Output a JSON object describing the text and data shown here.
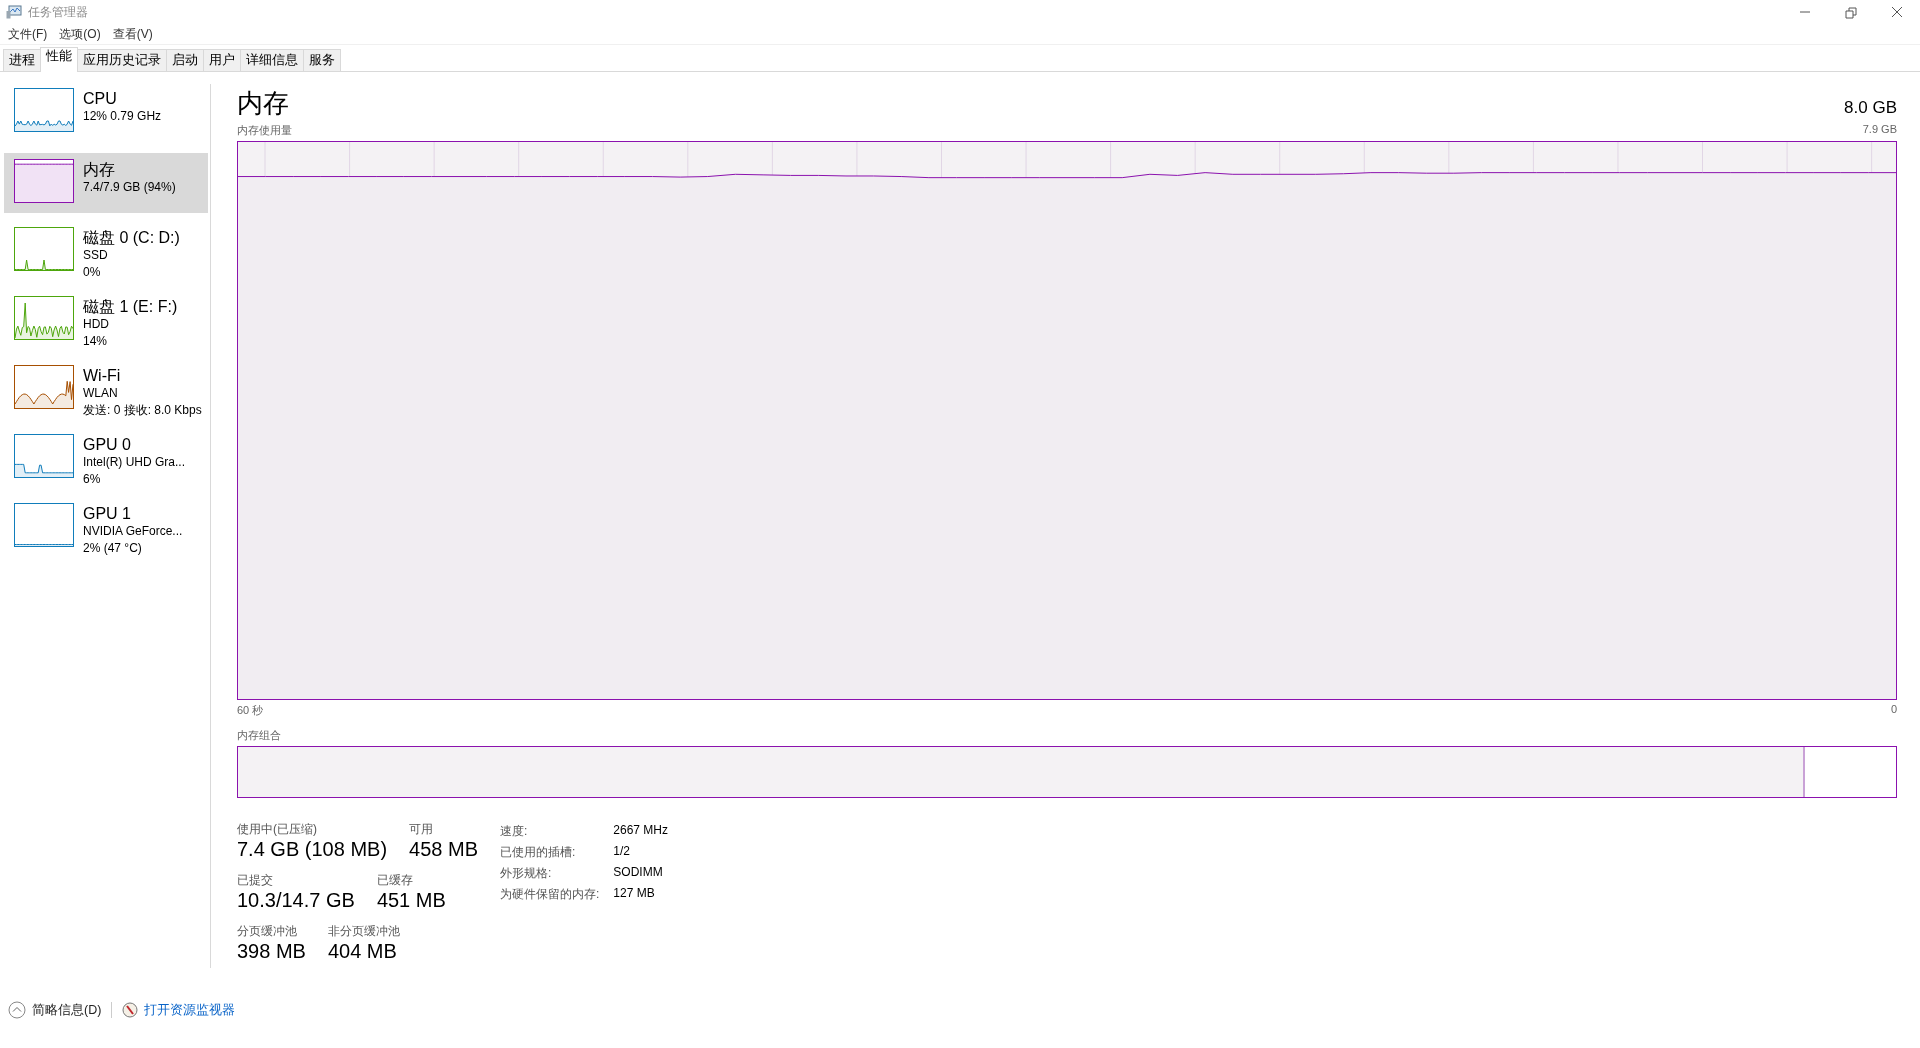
{
  "window": {
    "title": "任务管理器"
  },
  "menu": [
    "文件(F)",
    "选项(O)",
    "查看(V)"
  ],
  "tabs": [
    {
      "label": "进程",
      "selected": false
    },
    {
      "label": "性能",
      "selected": true
    },
    {
      "label": "应用历史记录",
      "selected": false
    },
    {
      "label": "启动",
      "selected": false
    },
    {
      "label": "用户",
      "selected": false
    },
    {
      "label": "详细信息",
      "selected": false
    },
    {
      "label": "服务",
      "selected": false
    }
  ],
  "sidebar": {
    "items": [
      {
        "kind": "cpu",
        "name": "CPU",
        "details": [
          "12% 0.79 GHz"
        ],
        "color": "#117dbb",
        "selected": false
      },
      {
        "kind": "memory",
        "name": "内存",
        "details": [
          "7.4/7.9 GB (94%)"
        ],
        "color": "#8b12ae",
        "selected": true
      },
      {
        "kind": "disk",
        "name": "磁盘 0 (C: D:)",
        "details": [
          "SSD",
          "0%"
        ],
        "color": "#4da60c",
        "selected": false
      },
      {
        "kind": "disk-busy",
        "name": "磁盘 1 (E: F:)",
        "details": [
          "HDD",
          "14%"
        ],
        "color": "#4da60c",
        "selected": false
      },
      {
        "kind": "network",
        "name": "Wi-Fi",
        "details": [
          "WLAN",
          "发送: 0 接收: 8.0 Kbps"
        ],
        "color": "#a74f01",
        "selected": false
      },
      {
        "kind": "gpu",
        "name": "GPU 0",
        "details": [
          "Intel(R) UHD Gra...",
          "6%"
        ],
        "color": "#117dbb",
        "selected": false
      },
      {
        "kind": "gpu-idle",
        "name": "GPU 1",
        "details": [
          "NVIDIA GeForce...",
          "2% (47 °C)"
        ],
        "color": "#117dbb",
        "selected": false
      }
    ]
  },
  "memory": {
    "title": "内存",
    "total": "8.0 GB",
    "usage_label": "内存使用量",
    "usage_max": "7.9 GB",
    "time_start": "60 秒",
    "time_end": "0",
    "composition_label": "内存组合",
    "composition": {
      "level": 0.944
    },
    "stats": [
      [
        {
          "label": "使用中(已压缩)",
          "value": "7.4 GB (108 MB)"
        },
        {
          "label": "可用",
          "value": "458 MB"
        }
      ],
      [
        {
          "label": "已提交",
          "value": "10.3/14.7 GB"
        },
        {
          "label": "已缓存",
          "value": "451 MB"
        }
      ],
      [
        {
          "label": "分页缓冲池",
          "value": "398 MB"
        },
        {
          "label": "非分页缓冲池",
          "value": "404 MB"
        }
      ]
    ],
    "specs": [
      {
        "label": "速度:",
        "value": "2667 MHz"
      },
      {
        "label": "已使用的插槽:",
        "value": "1/2"
      },
      {
        "label": "外形规格:",
        "value": "SODIMM"
      },
      {
        "label": "为硬件保留的内存:",
        "value": "127 MB"
      }
    ]
  },
  "footer": {
    "details_toggle": "简略信息(D)",
    "resource_monitor_link": "打开资源监视器"
  }
}
